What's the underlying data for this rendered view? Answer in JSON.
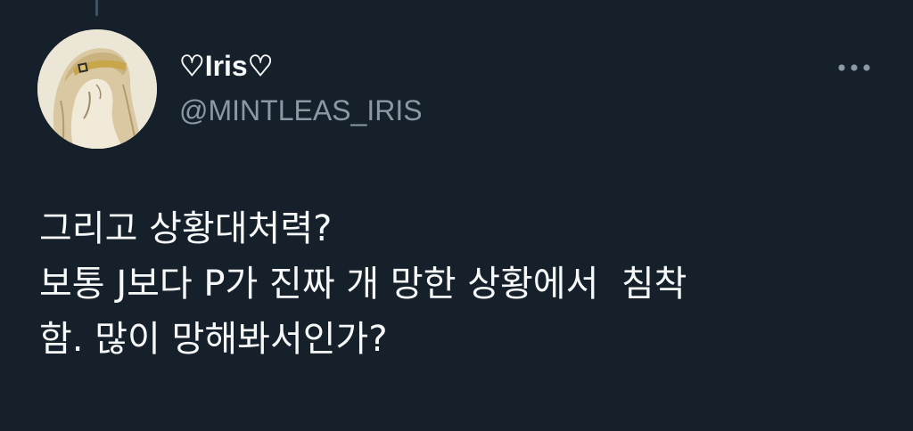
{
  "tweet": {
    "author": {
      "display_name": "♡Iris♡",
      "handle": "@MINTLEAS_IRIS",
      "avatar_icon": "profile-avatar"
    },
    "more_icon": "more-options-icon",
    "text_lines": [
      "그리고 상황대처력?",
      "보통 J보다 P가 진짜 개 망한 상황에서  침착",
      "함. 많이 망해봐서인가?"
    ]
  },
  "colors": {
    "background": "#15202b",
    "primary_text": "#f7f9f9",
    "secondary_text": "#8b98a5"
  }
}
